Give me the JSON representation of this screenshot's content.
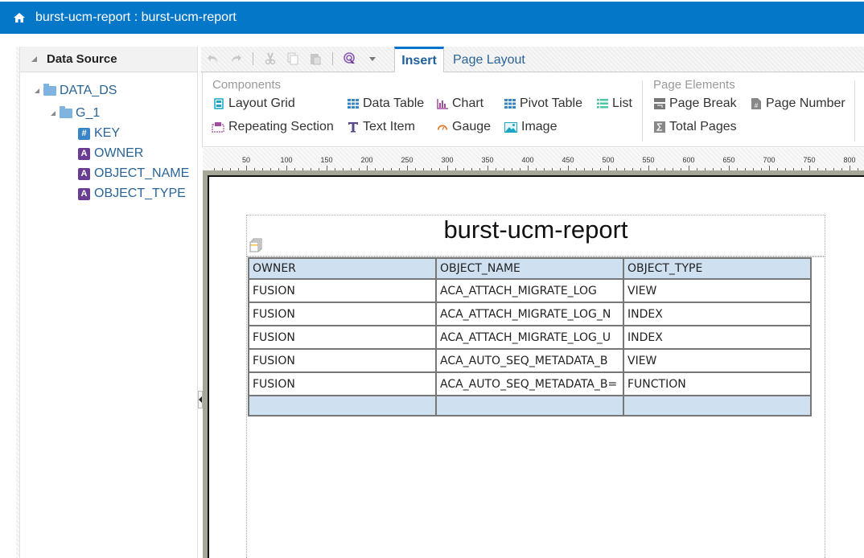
{
  "header": {
    "title": "burst-ucm-report : burst-ucm-report",
    "icon": "home-icon"
  },
  "data_source": {
    "title": "Data Source",
    "tree": [
      {
        "label": "DATA_DS",
        "type": "folder",
        "level": 0
      },
      {
        "label": "G_1",
        "type": "folder",
        "level": 1
      },
      {
        "label": "KEY",
        "type": "number",
        "badge": "#",
        "level": 2
      },
      {
        "label": "OWNER",
        "type": "text",
        "badge": "A",
        "level": 2
      },
      {
        "label": "OBJECT_NAME",
        "type": "text",
        "badge": "A",
        "level": 2
      },
      {
        "label": "OBJECT_TYPE",
        "type": "text",
        "badge": "A",
        "level": 2
      }
    ]
  },
  "toolbar": {
    "icons": [
      "undo-icon",
      "redo-icon",
      "cut-icon",
      "copy-icon",
      "paste-icon",
      "select-target-icon",
      "dropdown-icon"
    ]
  },
  "tabs": [
    {
      "label": "Insert",
      "active": true
    },
    {
      "label": "Page Layout",
      "active": false
    }
  ],
  "ribbon": {
    "components": {
      "title": "Components",
      "items": [
        {
          "label": "Layout Grid",
          "icon": "layout-grid-icon"
        },
        {
          "label": "Data Table",
          "icon": "data-table-icon"
        },
        {
          "label": "Chart",
          "icon": "chart-icon"
        },
        {
          "label": "Pivot Table",
          "icon": "pivot-table-icon"
        },
        {
          "label": "List",
          "icon": "list-icon"
        },
        {
          "label": "Repeating Section",
          "icon": "repeating-section-icon"
        },
        {
          "label": "Text Item",
          "icon": "text-item-icon"
        },
        {
          "label": "Gauge",
          "icon": "gauge-icon"
        },
        {
          "label": "Image",
          "icon": "image-icon"
        }
      ]
    },
    "page_elements": {
      "title": "Page Elements",
      "items": [
        {
          "label": "Page Break",
          "icon": "page-break-icon"
        },
        {
          "label": "Page Number",
          "icon": "page-number-icon"
        },
        {
          "label": "Total Pages",
          "icon": "total-pages-icon"
        }
      ]
    }
  },
  "ruler": {
    "labels": [
      "50",
      "100",
      "150",
      "200",
      "250",
      "300",
      "350",
      "400",
      "450",
      "500",
      "550",
      "600",
      "650",
      "700",
      "750",
      "800"
    ]
  },
  "report": {
    "title": "burst-ucm-report",
    "columns": [
      "OWNER",
      "OBJECT_NAME",
      "OBJECT_TYPE"
    ],
    "rows": [
      [
        "FUSION",
        "ACA_ATTACH_MIGRATE_LOG",
        "VIEW"
      ],
      [
        "FUSION",
        "ACA_ATTACH_MIGRATE_LOG_N",
        "INDEX"
      ],
      [
        "FUSION",
        "ACA_ATTACH_MIGRATE_LOG_U",
        "INDEX"
      ],
      [
        "FUSION",
        "ACA_AUTO_SEQ_METADATA_B",
        "VIEW"
      ],
      [
        "FUSION",
        "ACA_AUTO_SEQ_METADATA_B=",
        "FUNCTION"
      ]
    ]
  },
  "colors": {
    "header_bg": "#0577c9",
    "tab_accent": "#0572ce",
    "table_header_bg": "#cfe0f1",
    "link_text": "#2a6496",
    "text_badge": "#6a3d93",
    "number_badge": "#3a85c6"
  }
}
